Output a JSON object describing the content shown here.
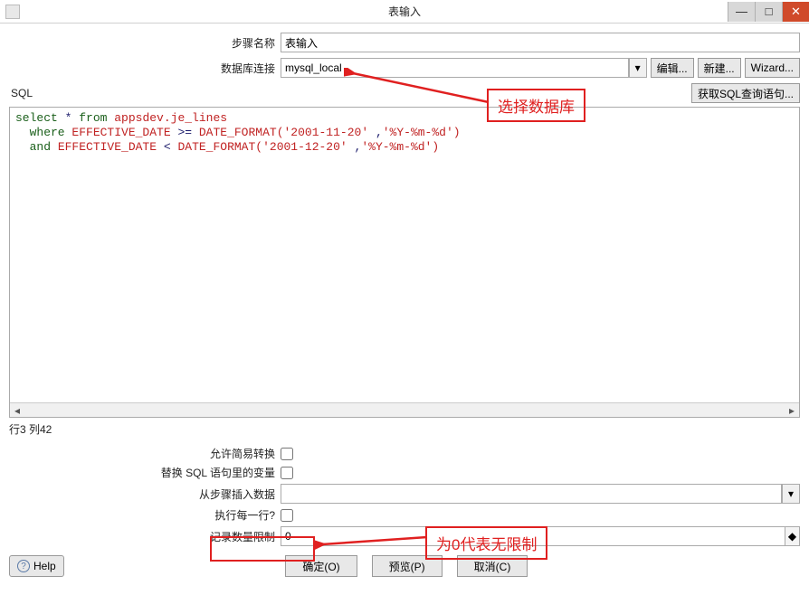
{
  "window": {
    "title": "表输入",
    "min_tip": "最小化",
    "max_tip": "还原",
    "close_tip": "关闭"
  },
  "form": {
    "step_name_label": "步骤名称",
    "step_name_value": "表输入",
    "db_connect_label": "数据库连接",
    "db_connect_value": "mysql_local",
    "edit_btn": "编辑...",
    "new_btn": "新建...",
    "wizard_btn": "Wizard..."
  },
  "sql": {
    "label": "SQL",
    "get_sql_btn": "获取SQL查询语句...",
    "tokens": [
      {
        "t": "select ",
        "c": "kw"
      },
      {
        "t": "*",
        "c": "all"
      },
      {
        "t": " from ",
        "c": "kw"
      },
      {
        "t": "appsdev.je_lines",
        "c": "ident"
      },
      {
        "t": "\n",
        "c": ""
      },
      {
        "t": "  where ",
        "c": "kw"
      },
      {
        "t": "EFFECTIVE_DATE",
        "c": "ident"
      },
      {
        "t": " ",
        "c": ""
      },
      {
        "t": ">=",
        "c": "all"
      },
      {
        "t": " ",
        "c": ""
      },
      {
        "t": "DATE_FORMAT(",
        "c": "ident"
      },
      {
        "t": "'2001-11-20'",
        "c": "str"
      },
      {
        "t": " ",
        "c": ""
      },
      {
        "t": ",",
        "c": "all"
      },
      {
        "t": "'%Y-%m-%d'",
        "c": "str"
      },
      {
        "t": ")",
        "c": "ident"
      },
      {
        "t": "\n",
        "c": ""
      },
      {
        "t": "  and ",
        "c": "kw"
      },
      {
        "t": "EFFECTIVE_DATE",
        "c": "ident"
      },
      {
        "t": " ",
        "c": ""
      },
      {
        "t": "<",
        "c": "all"
      },
      {
        "t": " ",
        "c": ""
      },
      {
        "t": "DATE_FORMAT(",
        "c": "ident"
      },
      {
        "t": "'2001-12-20'",
        "c": "str"
      },
      {
        "t": " ",
        "c": ""
      },
      {
        "t": ",",
        "c": "all"
      },
      {
        "t": "'%Y-%m-%d'",
        "c": "str"
      },
      {
        "t": ")",
        "c": "ident"
      }
    ],
    "cursor_status": "行3 列42"
  },
  "options": {
    "allow_simple_label": "允许简易转换",
    "replace_vars_label": "替换 SQL 语句里的变量",
    "from_step_label": "从步骤插入数据",
    "from_step_value": "",
    "exec_each_label": "执行每一行?",
    "limit_label": "记录数量限制",
    "limit_value": "0"
  },
  "buttons": {
    "help": "Help",
    "ok": "确定(O)",
    "preview": "预览(P)",
    "cancel": "取消(C)"
  },
  "callouts": {
    "c1": "选择数据库",
    "c2": "为0代表无限制"
  }
}
